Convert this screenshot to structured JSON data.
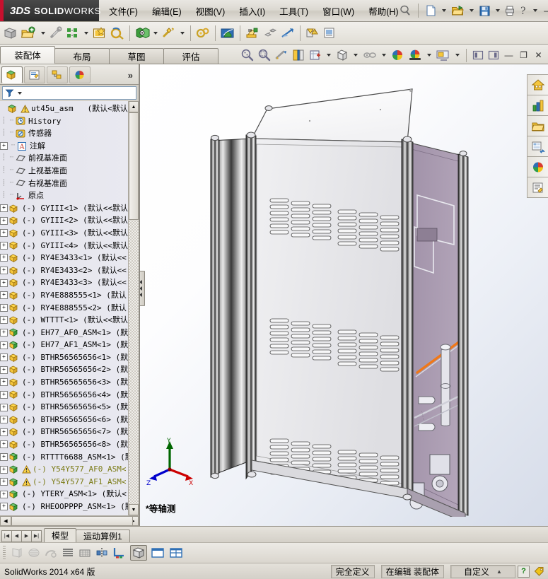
{
  "app": {
    "brand_ds": "3DS",
    "brand_bold": "SOLID",
    "brand_light": "WORKS",
    "version_text": "SolidWorks 2014 x64 版"
  },
  "menu": {
    "items": [
      {
        "label": "文件(F)",
        "name": "menu-file"
      },
      {
        "label": "编辑(E)",
        "name": "menu-edit"
      },
      {
        "label": "视图(V)",
        "name": "menu-view"
      },
      {
        "label": "插入(I)",
        "name": "menu-insert"
      },
      {
        "label": "工具(T)",
        "name": "menu-tools"
      },
      {
        "label": "窗口(W)",
        "name": "menu-window"
      },
      {
        "label": "帮助(H)",
        "name": "menu-help"
      }
    ]
  },
  "titlebar_icons": [
    {
      "name": "pin-icon"
    },
    {
      "name": "new-document-icon"
    },
    {
      "name": "open-document-icon"
    },
    {
      "name": "save-icon"
    },
    {
      "name": "print-icon"
    },
    {
      "name": "help-icon"
    }
  ],
  "window_controls": {
    "minimize": "—",
    "restore": "❐",
    "close": "✕"
  },
  "toolbar": {
    "icons": [
      {
        "name": "edit-component-icon"
      },
      {
        "name": "insert-components-icon"
      },
      {
        "name": "mate-icon"
      },
      {
        "name": "linear-component-pattern-icon"
      },
      {
        "name": "smart-fasteners-icon"
      },
      {
        "name": "move-component-icon"
      },
      {
        "name": "show-hidden-components-icon"
      },
      {
        "name": "assembly-features-icon"
      },
      {
        "name": "reference-geometry-icon"
      },
      {
        "name": "new-motion-study-icon"
      },
      {
        "name": "bill-of-materials-icon"
      },
      {
        "name": "exploded-view-icon"
      },
      {
        "name": "explode-line-sketch-icon"
      },
      {
        "name": "interference-detection-icon"
      },
      {
        "name": "performance-evaluation-icon"
      },
      {
        "name": "section-properties-icon"
      }
    ]
  },
  "command_tabs": [
    {
      "label": "装配体",
      "name": "tab-assembly",
      "active": true
    },
    {
      "label": "布局",
      "name": "tab-layout",
      "active": false
    },
    {
      "label": "草图",
      "name": "tab-sketch",
      "active": false
    },
    {
      "label": "评估",
      "name": "tab-evaluate",
      "active": false
    }
  ],
  "view_toolbar": {
    "icons": [
      {
        "name": "zoom-to-fit-icon"
      },
      {
        "name": "zoom-to-area-icon"
      },
      {
        "name": "previous-view-icon"
      },
      {
        "name": "section-view-icon"
      },
      {
        "name": "view-orientation-icon"
      },
      {
        "name": "display-style-icon"
      },
      {
        "name": "hide-show-items-icon"
      },
      {
        "name": "edit-appearance-icon"
      },
      {
        "name": "apply-scene-icon"
      },
      {
        "name": "view-settings-icon"
      },
      {
        "name": "restore-left-icon"
      },
      {
        "name": "restore-right-icon"
      }
    ]
  },
  "manager_tabs": [
    {
      "name": "feature-manager-tab",
      "label": "",
      "active": true
    },
    {
      "name": "property-manager-tab",
      "label": "",
      "active": false
    },
    {
      "name": "configuration-manager-tab",
      "label": "",
      "active": false
    },
    {
      "name": "display-manager-tab",
      "label": "",
      "active": false
    }
  ],
  "manager_overflow": "»",
  "filter": {
    "placeholder": "",
    "value": "",
    "icon": "filter-icon"
  },
  "tree": {
    "root": {
      "name": "ut45u_asm",
      "config": "(默认<默认_显",
      "icon": "assembly-icon",
      "warning": true
    },
    "items": [
      {
        "label": "History",
        "icon": "history-icon",
        "indent": 1,
        "expand": "none"
      },
      {
        "label": "传感器",
        "icon": "sensors-icon",
        "indent": 1,
        "expand": "none"
      },
      {
        "label": "注解",
        "icon": "annotations-icon",
        "indent": 1,
        "expand": "plus"
      },
      {
        "label": "前视基准面",
        "icon": "plane-icon",
        "indent": 1,
        "expand": "none"
      },
      {
        "label": "上视基准面",
        "icon": "plane-icon",
        "indent": 1,
        "expand": "none"
      },
      {
        "label": "右视基准面",
        "icon": "plane-icon",
        "indent": 1,
        "expand": "none"
      },
      {
        "label": "原点",
        "icon": "origin-icon",
        "indent": 1,
        "expand": "none"
      },
      {
        "label": "(-) GYIII<1>  (默认<<默认",
        "icon": "part-icon",
        "indent": 0,
        "expand": "plus"
      },
      {
        "label": "(-) GYIII<2>  (默认<<默认",
        "icon": "part-icon",
        "indent": 0,
        "expand": "plus"
      },
      {
        "label": "(-) GYIII<3>  (默认<<默认",
        "icon": "part-icon",
        "indent": 0,
        "expand": "plus"
      },
      {
        "label": "(-) GYIII<4>  (默认<<默认",
        "icon": "part-icon",
        "indent": 0,
        "expand": "plus"
      },
      {
        "label": "(-) RY4E3433<1>  (默认<<",
        "icon": "part-icon",
        "indent": 0,
        "expand": "plus"
      },
      {
        "label": "(-) RY4E3433<2>  (默认<<",
        "icon": "part-icon",
        "indent": 0,
        "expand": "plus"
      },
      {
        "label": "(-) RY4E3433<3>  (默认<<",
        "icon": "part-icon",
        "indent": 0,
        "expand": "plus"
      },
      {
        "label": "(-) RY4E888555<1>  (默认",
        "icon": "part-icon",
        "indent": 0,
        "expand": "plus"
      },
      {
        "label": "(-) RY4E888555<2>  (默认",
        "icon": "part-icon",
        "indent": 0,
        "expand": "plus"
      },
      {
        "label": "(-) WTTTT<1>  (默认<<默认",
        "icon": "part-icon",
        "indent": 0,
        "expand": "plus"
      },
      {
        "label": "(-) EH77_AF0_ASM<1>  (默",
        "icon": "subassembly-icon",
        "indent": 0,
        "expand": "plus"
      },
      {
        "label": "(-) EH77_AF1_ASM<1>  (默",
        "icon": "subassembly-icon",
        "indent": 0,
        "expand": "plus"
      },
      {
        "label": "(-) BTHR56565656<1>  (默",
        "icon": "part-icon",
        "indent": 0,
        "expand": "plus"
      },
      {
        "label": "(-) BTHR56565656<2>  (默",
        "icon": "part-icon",
        "indent": 0,
        "expand": "plus"
      },
      {
        "label": "(-) BTHR56565656<3>  (默",
        "icon": "part-icon",
        "indent": 0,
        "expand": "plus"
      },
      {
        "label": "(-) BTHR56565656<4>  (默",
        "icon": "part-icon",
        "indent": 0,
        "expand": "plus"
      },
      {
        "label": "(-) BTHR56565656<5>  (默",
        "icon": "part-icon",
        "indent": 0,
        "expand": "plus"
      },
      {
        "label": "(-) BTHR56565656<6>  (默",
        "icon": "part-icon",
        "indent": 0,
        "expand": "plus"
      },
      {
        "label": "(-) BTHR56565656<7>  (默",
        "icon": "part-icon",
        "indent": 0,
        "expand": "plus"
      },
      {
        "label": "(-) BTHR56565656<8>  (默",
        "icon": "part-icon",
        "indent": 0,
        "expand": "plus"
      },
      {
        "label": "(-) RTTTT6688_ASM<1>  (默",
        "icon": "subassembly-icon",
        "indent": 0,
        "expand": "plus"
      },
      {
        "label": "(-) Y54Y577_AF0_ASM<",
        "icon": "subassembly-icon",
        "indent": 0,
        "expand": "plus",
        "warning": true,
        "olive": true
      },
      {
        "label": "(-) Y54Y577_AF1_ASM<",
        "icon": "subassembly-icon",
        "indent": 0,
        "expand": "plus",
        "warning": true,
        "olive": true
      },
      {
        "label": "(-) YTERY_ASM<1>  (默认<",
        "icon": "subassembly-icon",
        "indent": 0,
        "expand": "plus"
      },
      {
        "label": "(-) RHEOOPPPP_ASM<1>  (默",
        "icon": "subassembly-icon",
        "indent": 0,
        "expand": "plus"
      }
    ]
  },
  "graphics": {
    "view_label": "*等轴测",
    "triad": {
      "x_label": "X",
      "y_label": "Y",
      "z_label": "Z",
      "x_color": "#cc0000",
      "y_color": "#006600",
      "z_color": "#0000cc"
    },
    "model": {
      "name": "cabinet-assembly",
      "panel_color": "#e8e8ea",
      "side_panel_color": "#a595ab",
      "frame_color": "#3a3a3a",
      "highlight_color": "#f07818",
      "top_color": "#fbfbfc"
    }
  },
  "task_pane": [
    {
      "name": "home-icon"
    },
    {
      "name": "design-library-resources-icon"
    },
    {
      "name": "file-explorer-icon"
    },
    {
      "name": "view-palette-icon"
    },
    {
      "name": "appearances-scenes-icon"
    },
    {
      "name": "custom-properties-icon"
    }
  ],
  "bottom_tabs": [
    {
      "label": "模型",
      "name": "tab-model",
      "active": true
    },
    {
      "label": "运动算例1",
      "name": "tab-motion-study-1",
      "active": false
    }
  ],
  "bottom_nav": [
    "|◀",
    "◀",
    "▶",
    "▶|"
  ],
  "bottom_toolbar": {
    "icons": [
      {
        "name": "draft-analysis-icon"
      },
      {
        "name": "zebra-stripes-icon"
      },
      {
        "name": "curvature-icon"
      },
      {
        "name": "horizontal-lines-icon"
      },
      {
        "name": "grid-icon"
      },
      {
        "name": "mirror-icon"
      },
      {
        "name": "coordinate-display-icon"
      },
      {
        "name": "shaded-icon"
      },
      {
        "name": "single-view-icon"
      },
      {
        "name": "four-view-icon"
      }
    ]
  },
  "status": {
    "version": "SolidWorks 2014 x64 版",
    "fully_defined": "完全定义",
    "editing": "在编辑 装配体",
    "custom": "自定义",
    "help_mark": "?"
  }
}
